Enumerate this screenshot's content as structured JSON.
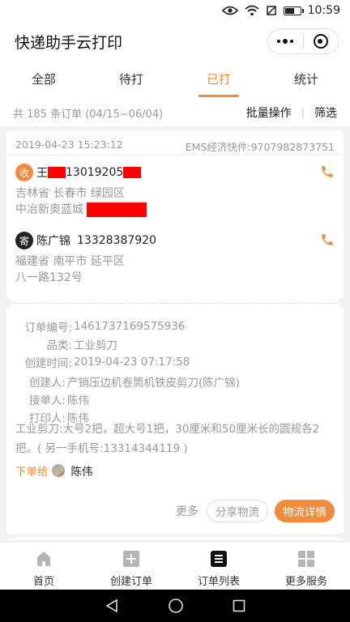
{
  "status_bar": {
    "time": "10:59"
  },
  "header": {
    "title": "快递助手云打印"
  },
  "tabs": [
    {
      "label": "全部",
      "active": false
    },
    {
      "label": "待打",
      "active": false
    },
    {
      "label": "已打",
      "active": true
    },
    {
      "label": "统计",
      "active": false
    }
  ],
  "summary": {
    "text": "共 185 条订单 (04/15~06/04)",
    "batch_label": "批量操作",
    "divider": "|",
    "filter_label": "筛选"
  },
  "order": {
    "print_time": "2019-04-23 15:23:12",
    "carrier": "EMS经济快件:9707982873751",
    "receiver": {
      "badge": "收",
      "name": "王",
      "phone": "13019205",
      "address_line1": "吉林省 长春市 绿园区",
      "address_line2": "中冶新奥蓝城"
    },
    "sender": {
      "badge": "寄",
      "name": "陈广锦",
      "phone": "13328387920",
      "address_line1": "福建省 南平市 延平区",
      "address_line2": "八一路132号"
    },
    "details": [
      {
        "label": "订单编号:",
        "value": "1461737169575936"
      },
      {
        "label": "品类:",
        "value": "工业剪刀"
      },
      {
        "label": "创建时间:",
        "value": "2019-04-23 07:17:58"
      }
    ],
    "people": [
      {
        "label": "创建人:",
        "value": "产销压边机卷筒机铁皮剪刀(陈广锦)"
      },
      {
        "label": "接单人:",
        "value": "陈伟"
      },
      {
        "label": "打印人:",
        "value": "陈伟"
      }
    ],
    "note_line1": "工业剪刀:大号2把，超大号1把，30厘米和50厘米长的圆规各2",
    "note_line2": "把。( 另一手机号:13314344119 )",
    "assign_label": "下单给",
    "assign_name": "陈伟",
    "more_label": "更多",
    "share_label": "分享物流",
    "detail_label": "物流详情"
  },
  "tabbar": [
    {
      "label": "首页",
      "icon": "home-icon"
    },
    {
      "label": "创建订单",
      "icon": "plus-square-icon"
    },
    {
      "label": "订单列表",
      "icon": "list-icon"
    },
    {
      "label": "更多服务",
      "icon": "grid-icon"
    }
  ],
  "colors": {
    "accent": "#f08a3c",
    "redaction": "#ff0000"
  }
}
